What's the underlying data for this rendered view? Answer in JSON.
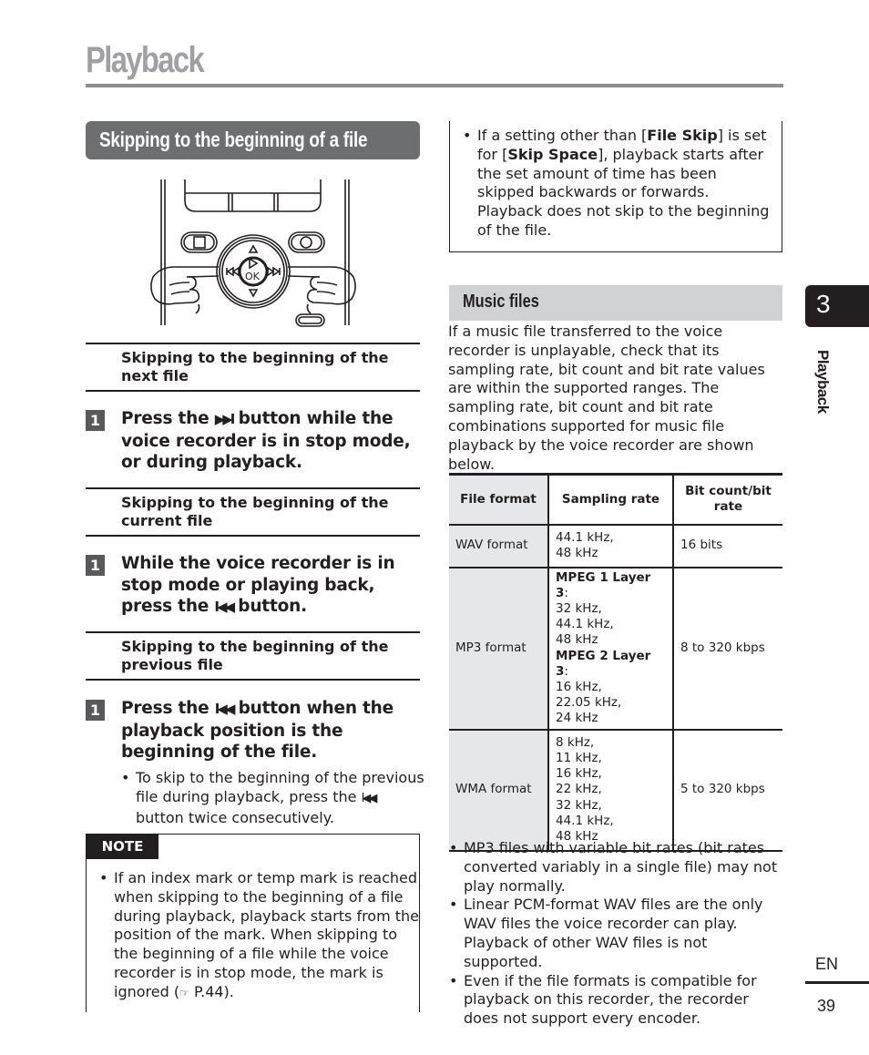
{
  "page": {
    "title": "Playback",
    "section_title": "Skipping to the beginning of a file",
    "chapter_number": "3",
    "chapter_label": "Playback",
    "language": "EN",
    "page_number": "39"
  },
  "illustration": {
    "ok_label": "OK",
    "description": "voice-recorder-buttons-with-hands"
  },
  "left": {
    "next": {
      "heading": "Skipping to the beginning of the next file",
      "step_number": "1",
      "step_pre": "Press the ",
      "step_icon": "▶▶I",
      "step_post": " button while the voice recorder is in stop mode, or during playback."
    },
    "current": {
      "heading": "Skipping to the beginning of the current file",
      "step_number": "1",
      "step_pre": "While the voice recorder is in stop mode or playing back, press the ",
      "step_icon": "I◀◀",
      "step_post": " button."
    },
    "previous": {
      "heading": "Skipping to the beginning of the previous file",
      "step_number": "1",
      "step_pre": "Press the ",
      "step_icon": "I◀◀",
      "step_post": " button when the playback position is the beginning of the file.",
      "bullet_pre": "To skip to the beginning of the previous file during playback, press the ",
      "bullet_icon": "I◀◀",
      "bullet_post": " button twice consecutively."
    },
    "note": {
      "label": "NOTE",
      "text_pre": "If an index mark or temp mark is reached when skipping to the beginning of a file during playback, playback starts from the position of the mark. When skipping to the beginning of a file while the voice recorder is in stop mode, the mark is ignored (",
      "ref_icon": "☞",
      "ref": " P.44",
      "text_post": ")."
    }
  },
  "right": {
    "tip": {
      "pre": "If a setting other than [",
      "bold1": "File Skip",
      "mid": "] is set for [",
      "bold2": "Skip Space",
      "post": "], playback starts after the set amount of time has been skipped backwards or forwards. Playback does not skip to the beginning of the file."
    },
    "music": {
      "heading": "Music files",
      "intro": "If a music file transferred to the voice recorder is unplayable, check that its sampling rate, bit count and bit rate values are within the supported ranges. The sampling rate, bit count and bit rate combinations supported for music file playback by the voice recorder are shown below.",
      "table": {
        "headers": [
          "File format",
          "Sampling rate",
          "Bit count/bit rate"
        ],
        "rows": [
          {
            "format": "WAV format",
            "sampling": [
              "44.1 kHz,",
              "48 kHz"
            ],
            "bitrate": "16 bits"
          },
          {
            "format": "MP3 format",
            "mpeg1_label": "MPEG 1 Layer 3",
            "mpeg1_rates": [
              "32 kHz,",
              "44.1 kHz,",
              "48 kHz"
            ],
            "mpeg2_label": "MPEG 2 Layer 3",
            "mpeg2_rates": [
              "16 kHz,",
              "22.05 kHz,",
              "24 kHz"
            ],
            "bitrate": "8 to 320 kbps"
          },
          {
            "format": "WMA format",
            "sampling": [
              "8 kHz,",
              "11 kHz,",
              "16 kHz,",
              "22 kHz,",
              "32 kHz,",
              "44.1 kHz,",
              "48 kHz"
            ],
            "bitrate": "5 to 320 kbps"
          }
        ]
      },
      "notes": [
        "MP3 files with variable bit rates (bit rates converted variably in a single file) may not play normally.",
        "Linear PCM-format WAV files are the only WAV files the voice recorder can play. Playback of other WAV files is not supported.",
        "Even if the file formats is compatible for playback on this recorder, the recorder does not support every encoder."
      ]
    }
  }
}
